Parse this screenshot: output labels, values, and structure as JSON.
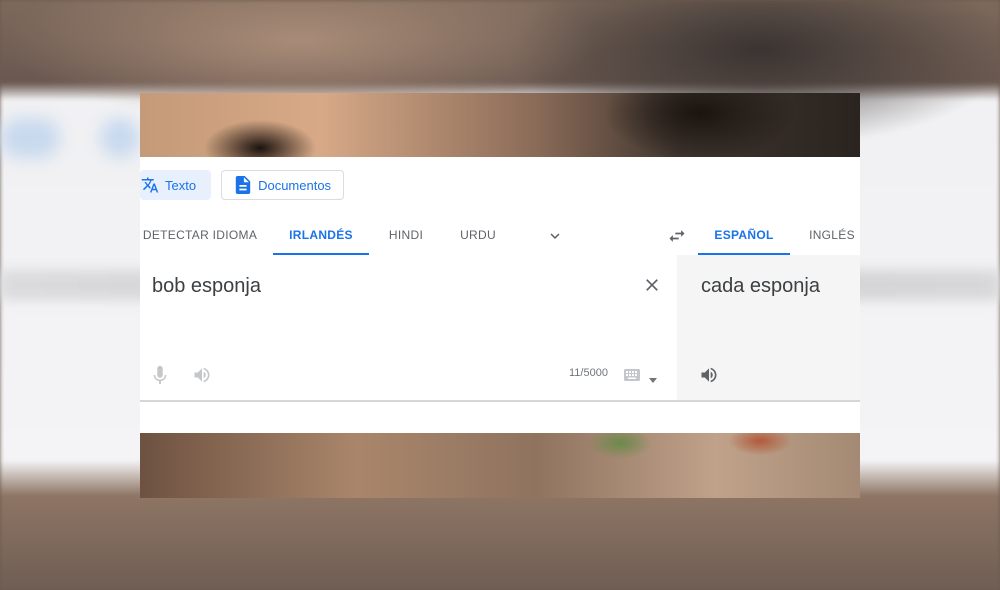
{
  "modes": {
    "text_label": "Texto",
    "documents_label": "Documentos"
  },
  "languages": {
    "source_tabs": [
      {
        "label": "DETECTAR IDIOMA",
        "active": false
      },
      {
        "label": "IRLANDÉS",
        "active": true
      },
      {
        "label": "HINDI",
        "active": false
      },
      {
        "label": "URDU",
        "active": false
      }
    ],
    "target_tabs": [
      {
        "label": "ESPAÑOL",
        "active": true
      },
      {
        "label": "INGLÉS",
        "active": false
      }
    ]
  },
  "source": {
    "text": "bob esponja",
    "char_count": "11/5000"
  },
  "target": {
    "text": "cada esponja"
  },
  "colors": {
    "accent": "#1a73e8",
    "muted": "#5f6368",
    "target_panel": "#f5f5f5"
  },
  "icons": [
    "translate-icon",
    "document-icon",
    "chevron-down-icon",
    "swap-icon",
    "close-icon",
    "microphone-icon",
    "speaker-icon",
    "keyboard-icon"
  ]
}
